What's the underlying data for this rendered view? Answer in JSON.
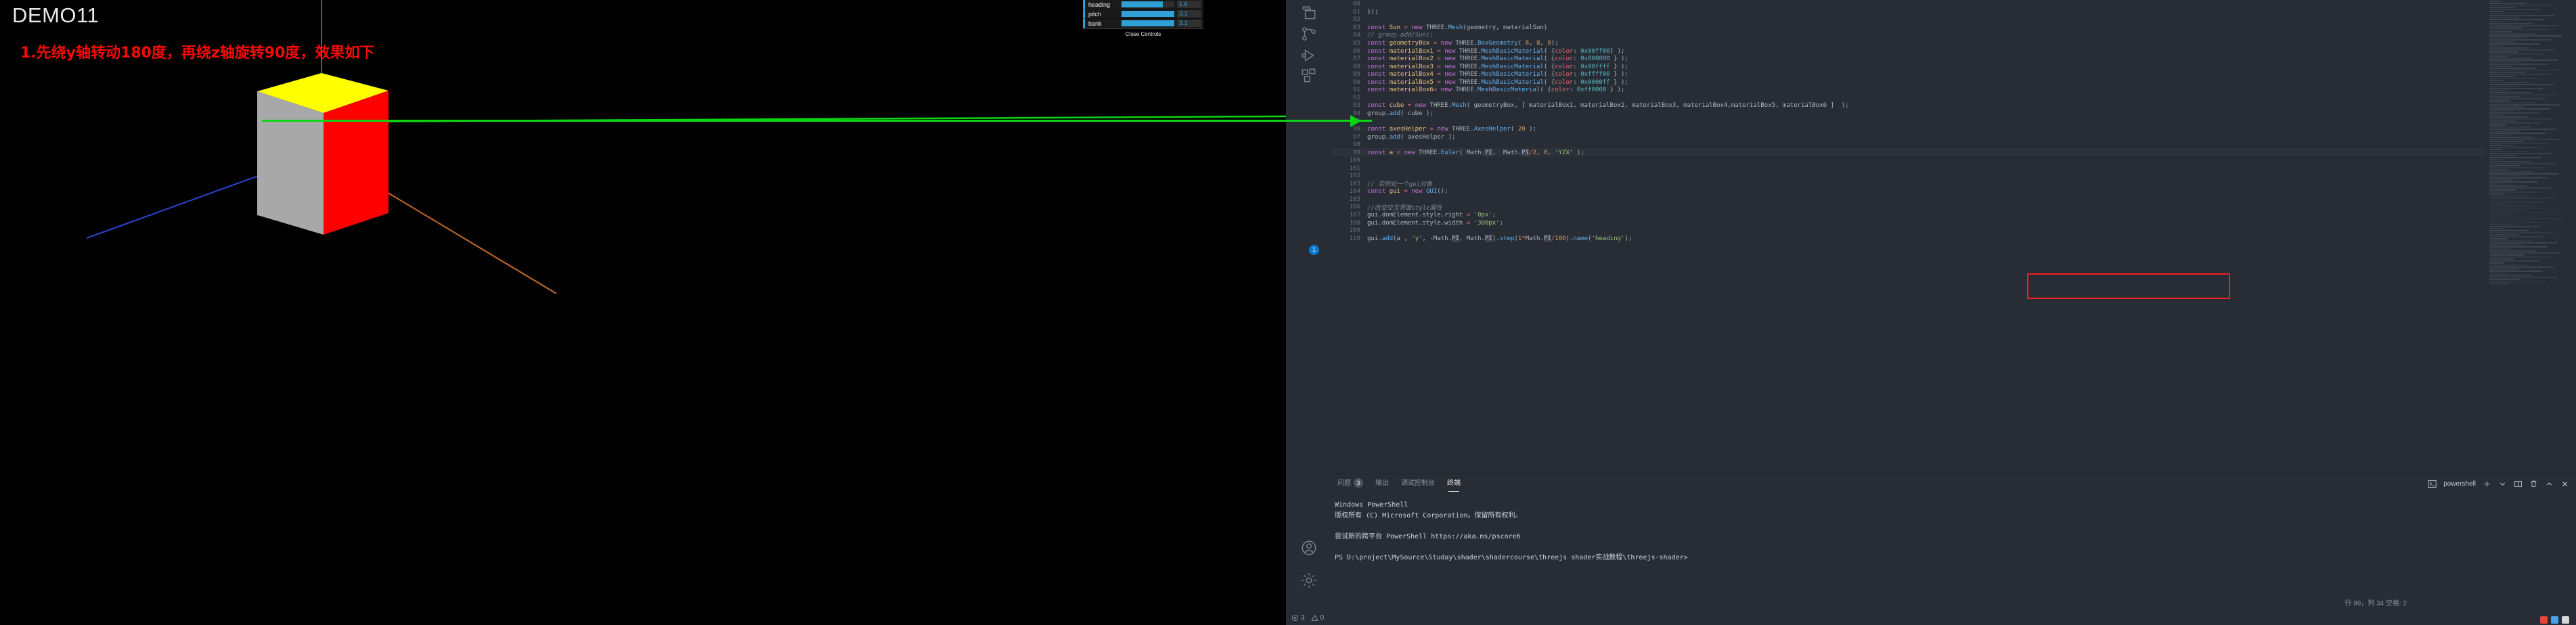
{
  "viewport": {
    "title": "DEMO11",
    "note": "1.先绕y轴转动180度，再绕z轴旋转90度，效果如下",
    "title_color": "#e8e8e8",
    "note_color": "#f40b08",
    "background": "#000000"
  },
  "gui_panel": {
    "controls": [
      {
        "name": "heading",
        "value": "1.6",
        "fill_percent": 78
      },
      {
        "name": "pitch",
        "value": "3.1",
        "fill_percent": 100
      },
      {
        "name": "bank",
        "value": "3.1",
        "fill_percent": 100
      }
    ],
    "close_label": "Close Controls",
    "accent": "#2fa1d6"
  },
  "cube": {
    "face_top_color": "#ffff00",
    "face_left_color": "#a8a8a8",
    "face_right_color": "#ff0000"
  },
  "axes": {
    "x_color": "#c96a2a",
    "y_color": "#0bd713",
    "z_color": "#2b43cf"
  },
  "activity_bar": {
    "items": [
      {
        "name": "explorer-icon"
      },
      {
        "name": "source-control-icon"
      },
      {
        "name": "run-debug-icon"
      },
      {
        "name": "extensions-icon"
      },
      {
        "name": "accounts-icon"
      },
      {
        "name": "settings-gear-icon",
        "badge": "1"
      }
    ]
  },
  "editor": {
    "first_line": 80,
    "highlight_line": 99,
    "lines": [
      {
        "n": 80,
        "html": ""
      },
      {
        "n": 81,
        "html": "<span class='pl'>});</span>"
      },
      {
        "n": 82,
        "html": ""
      },
      {
        "n": 83,
        "html": "<span class='kw'>const</span> <span class='kw2'>Sun</span> <span class='prop'>=</span> <span class='kw'>new</span> <span class='pl'>THREE.</span><span class='fn'>Mesh</span><span class='pl'>(geometry, materialSun)</span>"
      },
      {
        "n": 84,
        "html": "<span class='cmt'>// group.add(Sun);</span>"
      },
      {
        "n": 85,
        "html": "<span class='kw'>const</span> <span class='kw2'>geometryBox</span> <span class='prop'>=</span> <span class='kw'>new</span> <span class='pl'>THREE.</span><span class='fn'>BoxGeometry</span><span class='pl'>( </span><span class='num'>8</span><span class='pl'>, </span><span class='num'>8</span><span class='pl'>, </span><span class='num'>8</span><span class='pl'>);</span>"
      },
      {
        "n": 86,
        "html": "<span class='kw'>const</span> <span class='kw2'>materialBox1</span> <span class='prop'>=</span> <span class='kw'>new</span> <span class='pl'>THREE.</span><span class='fn'>MeshBasicMaterial</span><span class='pl'>( {</span><span class='prop'>color</span><span class='pl'>: </span><span class='hex'>0x00ff00</span><span class='pl'>} );</span>"
      },
      {
        "n": 87,
        "html": "<span class='kw'>const</span> <span class='kw2'>materialBox2</span> <span class='prop'>=</span> <span class='kw'>new</span> <span class='pl'>THREE.</span><span class='fn'>MeshBasicMaterial</span><span class='pl'>( {</span><span class='prop'>color</span><span class='pl'>: </span><span class='hex'>0x808080</span><span class='pl'> } );</span>"
      },
      {
        "n": 88,
        "html": "<span class='kw'>const</span> <span class='kw2'>materialBox3</span> <span class='prop'>=</span> <span class='kw'>new</span> <span class='pl'>THREE.</span><span class='fn'>MeshBasicMaterial</span><span class='pl'>( {</span><span class='prop'>color</span><span class='pl'>: </span><span class='hex'>0x00ffff</span><span class='pl'> } );</span>"
      },
      {
        "n": 89,
        "html": "<span class='kw'>const</span> <span class='kw2'>materialBox4</span> <span class='prop'>=</span> <span class='kw'>new</span> <span class='pl'>THREE.</span><span class='fn'>MeshBasicMaterial</span><span class='pl'>( {</span><span class='prop'>color</span><span class='pl'>: </span><span class='hex'>0xffff00</span><span class='pl'> } );</span>"
      },
      {
        "n": 90,
        "html": "<span class='kw'>const</span> <span class='kw2'>materialBox5</span> <span class='prop'>=</span> <span class='kw'>new</span> <span class='pl'>THREE.</span><span class='fn'>MeshBasicMaterial</span><span class='pl'>( {</span><span class='prop'>color</span><span class='pl'>: </span><span class='hex'>0x0000ff</span><span class='pl'> } );</span>"
      },
      {
        "n": 91,
        "html": "<span class='kw'>const</span> <span class='kw2'>materialBox6</span><span class='prop'>=</span> <span class='kw'>new</span> <span class='pl'>THREE.</span><span class='fn'>MeshBasicMaterial</span><span class='pl'>( {</span><span class='prop'>color</span><span class='pl'>: </span><span class='hex'>0xff0000</span><span class='pl'> } );</span>"
      },
      {
        "n": 92,
        "html": ""
      },
      {
        "n": 93,
        "html": "<span class='kw'>const</span> <span class='kw2'>cube</span> <span class='prop'>=</span> <span class='kw'>new</span> <span class='pl'>THREE.</span><span class='fn'>Mesh</span><span class='pl'>( geometryBox, [ materialBox1, materialBox2, materialBox3, materialBox4,materialBox5, materialBox6 ]  );</span>"
      },
      {
        "n": 94,
        "html": "<span class='pl'>group.</span><span class='fn'>add</span><span class='pl'>( cube );</span>"
      },
      {
        "n": 95,
        "html": ""
      },
      {
        "n": 96,
        "html": "<span class='kw'>const</span> <span class='kw2'>axesHelper</span> <span class='prop'>=</span> <span class='kw'>new</span> <span class='pl'>THREE.</span><span class='fn'>AxesHelper</span><span class='pl'>( </span><span class='num'>20</span><span class='pl'> );</span>"
      },
      {
        "n": 97,
        "html": "<span class='pl'>group.</span><span class='fn'>add</span><span class='pl'>( axesHelper );</span>"
      },
      {
        "n": 98,
        "html": ""
      },
      {
        "n": 99,
        "html": "<span class='kw'>const</span> <span class='kw2'>a</span> <span class='prop'>=</span> <span class='kw'>new</span> <span class='pl'>THREE.</span><span class='fn'>Euler</span><span class='pl'>( Math.</span><span class='sel'>PI</span><span class='pl'>,  Math.</span><span class='sel'>PI</span><span class='prop'>/</span><span class='num'>2</span><span class='pl'>, </span><span class='num'>0</span><span class='pl'>, </span><span class='str'>'YZX'</span><span class='pl'> );</span>"
      },
      {
        "n": 100,
        "html": ""
      },
      {
        "n": 101,
        "html": ""
      },
      {
        "n": 102,
        "html": ""
      },
      {
        "n": 103,
        "html": "<span class='cmt'>// 实例化一个gui对象</span>"
      },
      {
        "n": 104,
        "html": "<span class='kw'>const</span> <span class='kw2'>gui</span> <span class='prop'>=</span> <span class='kw'>new</span> <span class='fn'>GUI</span><span class='pl'>();</span>"
      },
      {
        "n": 105,
        "html": ""
      },
      {
        "n": 106,
        "html": "<span class='cmt'>//改变交互界面style属性</span>"
      },
      {
        "n": 107,
        "html": "<span class='pl'>gui.domElement.style.right </span><span class='prop'>=</span> <span class='str'>'0px'</span><span class='pl'>;</span>"
      },
      {
        "n": 108,
        "html": "<span class='pl'>gui.domElement.style.width </span><span class='prop'>=</span> <span class='str'>'300px'</span><span class='pl'>;</span>"
      },
      {
        "n": 109,
        "html": ""
      },
      {
        "n": 110,
        "html": "<span class='pl'>gui.</span><span class='fn'>add</span><span class='pl'>(a , </span><span class='str'>'y'</span><span class='pl'>, -Math.</span><span class='sel'>PI</span><span class='pl'>, Math.</span><span class='sel'>PI</span><span class='pl'>).</span><span class='fn'>step</span><span class='pl'>(</span><span class='num'>1</span><span class='prop'>*</span><span class='pl'>Math.</span><span class='sel'>PI</span><span class='prop'>/</span><span class='num'>180</span><span class='pl'>).</span><span class='fn'>name</span><span class='pl'>(</span><span class='str'>'heading'</span><span class='pl'>);</span>"
      }
    ]
  },
  "panel": {
    "tabs": [
      {
        "label": "问题",
        "badge": "3",
        "active": false
      },
      {
        "label": "输出",
        "badge": "",
        "active": false
      },
      {
        "label": "调试控制台",
        "badge": "",
        "active": false
      },
      {
        "label": "终端",
        "badge": "",
        "active": true
      }
    ],
    "shell_name": "powershell",
    "terminal_lines": [
      "Windows PowerShell",
      "版权所有 (C) Microsoft Corporation。保留所有权利。",
      "",
      "尝试新的跨平台 PowerShell https://aka.ms/pscore6",
      "",
      "PS D:\\project\\MySource\\Studay\\shader\\shadercourse\\threejs shader实战教程\\threejs-shader>"
    ]
  },
  "status_bar": {
    "errors": "3",
    "warnings": "0",
    "cursor_position": "行 99，列 34   空格: 2"
  }
}
